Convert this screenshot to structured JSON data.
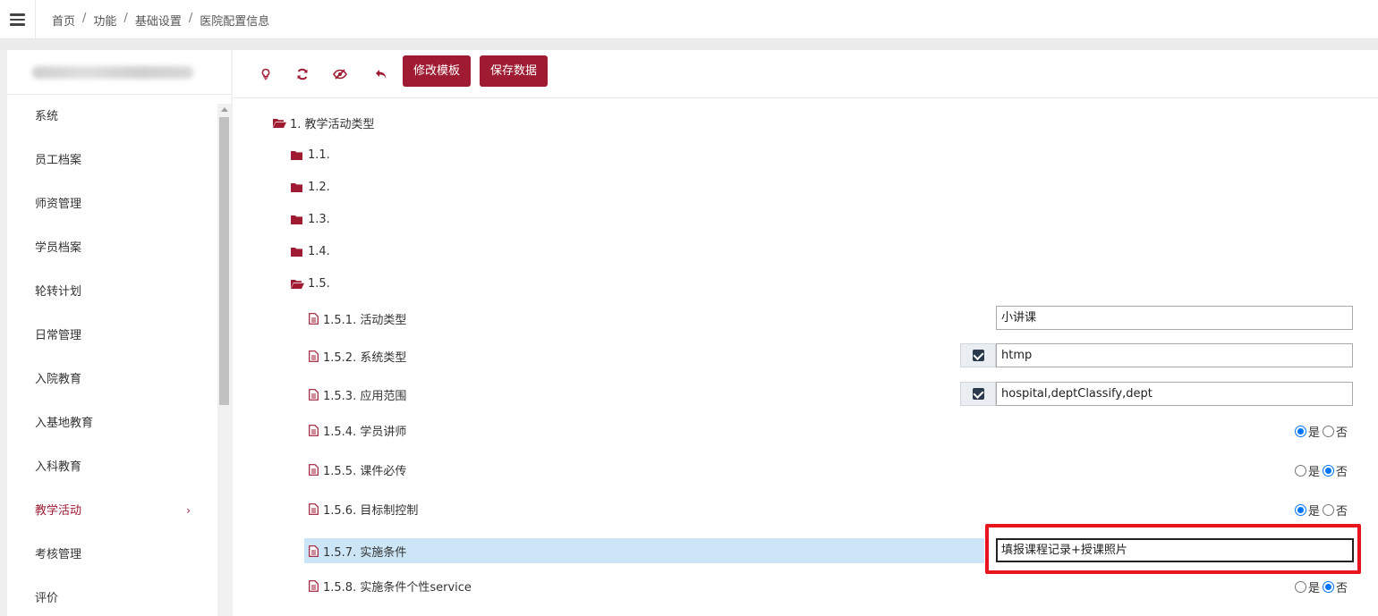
{
  "breadcrumb": [
    "首页",
    "功能",
    "基础设置",
    "医院配置信息"
  ],
  "sidebar": {
    "items": [
      {
        "label": "系统"
      },
      {
        "label": "员工档案"
      },
      {
        "label": "师资管理"
      },
      {
        "label": "学员档案"
      },
      {
        "label": "轮转计划"
      },
      {
        "label": "日常管理"
      },
      {
        "label": "入院教育"
      },
      {
        "label": "入基地教育"
      },
      {
        "label": "入科教育"
      },
      {
        "label": "教学活动",
        "active": true
      },
      {
        "label": "考核管理"
      },
      {
        "label": "评价"
      }
    ]
  },
  "toolbar": {
    "icons": [
      "bulb-icon",
      "refresh-icon",
      "hide-icon",
      "undo-icon"
    ],
    "edit_template": "修改模板",
    "save_data": "保存数据"
  },
  "tree": {
    "root": "1. 教学活动类型",
    "folders": [
      "1.1.",
      "1.2.",
      "1.3.",
      "1.4.",
      "1.5."
    ],
    "fields": [
      {
        "label": "1.5.1. 活动类型",
        "type": "text",
        "value": "小讲课"
      },
      {
        "label": "1.5.2. 系统类型",
        "type": "text-check",
        "value": "htmp"
      },
      {
        "label": "1.5.3. 应用范围",
        "type": "text-check",
        "value": "hospital,deptClassify,dept"
      },
      {
        "label": "1.5.4. 学员讲师",
        "type": "radio",
        "value": "是"
      },
      {
        "label": "1.5.5. 课件必传",
        "type": "radio",
        "value": "否"
      },
      {
        "label": "1.5.6. 目标制控制",
        "type": "radio",
        "value": "是"
      },
      {
        "label": "1.5.7. 实施条件",
        "type": "text",
        "value": "填报课程记录+授课照片"
      },
      {
        "label": "1.5.8. 实施条件个性service",
        "type": "radio",
        "value": "否"
      }
    ],
    "radio_yes": "是",
    "radio_no": "否"
  },
  "colors": {
    "accent": "#9e1b32",
    "highlight": "#cce6f7",
    "callout": "#e8161c"
  }
}
